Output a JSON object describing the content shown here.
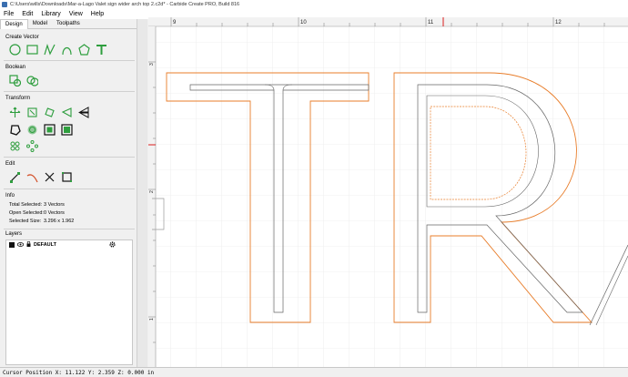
{
  "window": {
    "title": "C:\\Users\\wills\\Downloads\\Mar-a-Lago Valet sign wider arch top 2.c2d* - Carbide Create PRO, Build 816"
  },
  "menu": [
    "File",
    "Edit",
    "Library",
    "View",
    "Help"
  ],
  "tabs": [
    "Design",
    "Model",
    "Toolpaths"
  ],
  "sections": {
    "create_vector": "Create Vector",
    "boolean": "Boolean",
    "transform": "Transform",
    "edit": "Edit",
    "info": "Info",
    "layers": "Layers"
  },
  "info": {
    "total_selected_label": "Total Selected:",
    "total_selected_value": "3 Vectors",
    "open_selected_label": "Open Selected:",
    "open_selected_value": "0 Vectors",
    "selected_size_label": "Selected Size:",
    "selected_size_value": "3.296 x 1.962"
  },
  "layers": [
    {
      "name": "DEFAULT",
      "color": "#111111"
    }
  ],
  "ruler": {
    "top_labels": [
      "9",
      "10",
      "11",
      "12"
    ],
    "left_labels": [
      "3",
      "2",
      "1"
    ]
  },
  "status": {
    "cursor": "Cursor Position X: 11.122 Y: 2.359 Z: 0.000 in"
  },
  "colors": {
    "accent_orange": "#e87d2a",
    "icon_green": "#2e9e3e",
    "ruler_marker": "#d91e1e"
  }
}
